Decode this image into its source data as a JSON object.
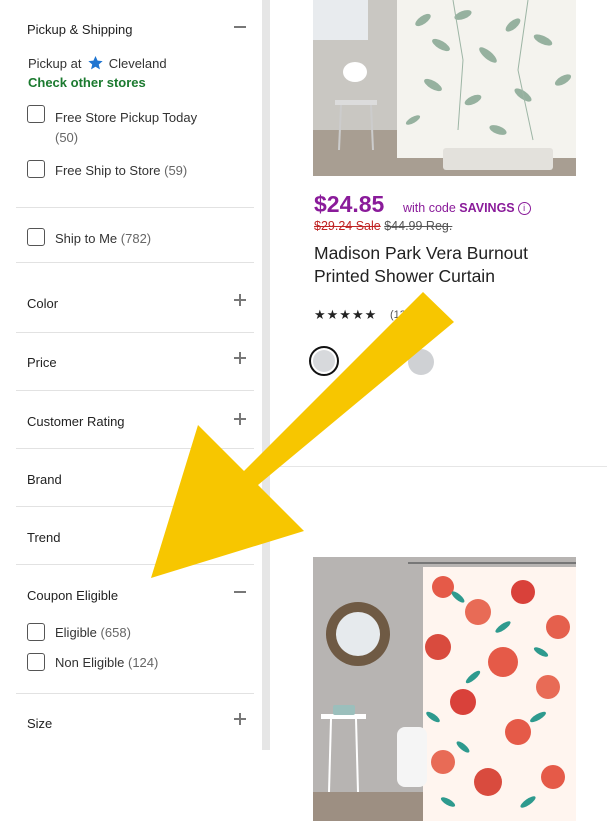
{
  "filters": {
    "pickup_shipping": {
      "title": "Pickup & Shipping",
      "pickup_at": "Pickup at",
      "store_name": "Cleveland",
      "check_other": "Check other stores",
      "options": [
        {
          "label": "Free Store Pickup Today",
          "count": "(50)"
        },
        {
          "label": "Free Ship to Store",
          "count": "(59)"
        },
        {
          "label": "Ship to Me",
          "count": "(782)"
        }
      ]
    },
    "sections": [
      {
        "title": "Color"
      },
      {
        "title": "Price"
      },
      {
        "title": "Customer Rating"
      },
      {
        "title": "Brand"
      },
      {
        "title": "Trend"
      }
    ],
    "coupon": {
      "title": "Coupon Eligible",
      "options": [
        {
          "label": "Eligible",
          "count": "(658)"
        },
        {
          "label": "Non Eligible",
          "count": "(124)"
        }
      ]
    },
    "size": {
      "title": "Size"
    }
  },
  "product1": {
    "price": "$24.85",
    "with_code": "with code",
    "code": "SAVINGS",
    "sale_price": "$29.24 Sale",
    "reg_price": "$44.99 Reg.",
    "name": "Madison Park Vera Burnout Printed Shower Curtain",
    "stars": "★★★★★",
    "rating": 4.5,
    "review_count": "(13",
    "swatches": [
      "#d7d9dc",
      "#e0e0e0",
      "#cfd1d4"
    ]
  },
  "colors": {
    "accent_purple": "#8a1b9a",
    "green": "#1b7a2f",
    "arrow_yellow": "#f7c600",
    "sale_red": "#c02424"
  },
  "icons": {
    "store": "star-icon",
    "collapse": "minus-icon",
    "expand": "plus-icon",
    "info": "info-icon"
  }
}
